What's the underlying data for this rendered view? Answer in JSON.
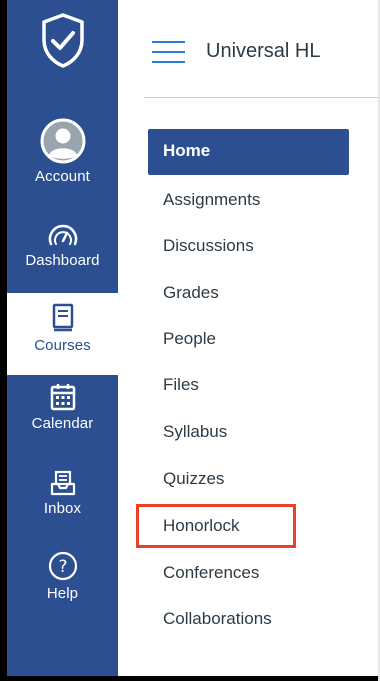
{
  "global_nav": {
    "items": [
      {
        "label": "Account",
        "icon": "account-avatar-icon"
      },
      {
        "label": "Dashboard",
        "icon": "dashboard-gauge-icon"
      },
      {
        "label": "Courses",
        "icon": "courses-book-icon",
        "active": true
      },
      {
        "label": "Calendar",
        "icon": "calendar-icon"
      },
      {
        "label": "Inbox",
        "icon": "inbox-icon"
      },
      {
        "label": "Help",
        "icon": "help-question-icon"
      }
    ]
  },
  "header": {
    "course_title": "Universal HL"
  },
  "course_nav": {
    "items": [
      {
        "label": "Home",
        "active": true
      },
      {
        "label": "Assignments"
      },
      {
        "label": "Discussions"
      },
      {
        "label": "Grades"
      },
      {
        "label": "People"
      },
      {
        "label": "Files"
      },
      {
        "label": "Syllabus"
      },
      {
        "label": "Quizzes"
      },
      {
        "label": "Honorlock",
        "highlighted": true
      },
      {
        "label": "Conferences"
      },
      {
        "label": "Collaborations"
      }
    ]
  },
  "colors": {
    "nav_blue": "#2b4f90",
    "accent_blue": "#2d7bd0",
    "highlight_red": "#e8402b",
    "text_dark": "#2d3b45"
  }
}
